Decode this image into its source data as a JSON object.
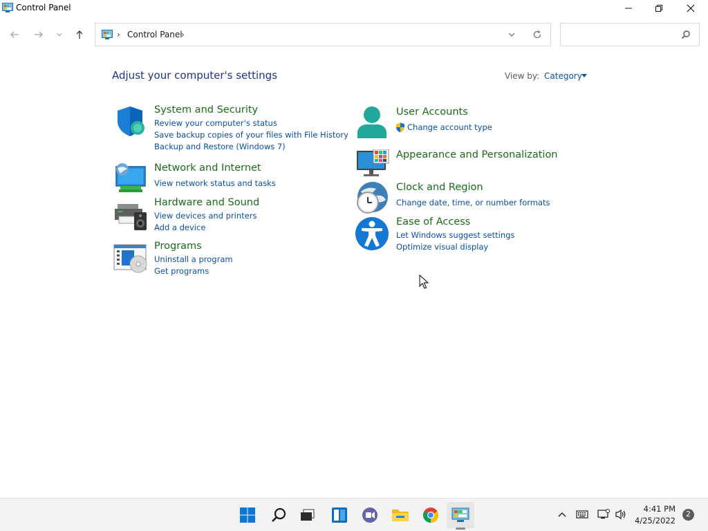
{
  "window": {
    "title": "Control Panel"
  },
  "address_bar": {
    "breadcrumbs": [
      "Control Panel"
    ],
    "search_placeholder": ""
  },
  "header": {
    "heading": "Adjust your computer's settings",
    "view_by_label": "View by:",
    "view_by_value": "Category"
  },
  "categories": [
    {
      "title": "System and Security",
      "icon": "shield-icon",
      "links": [
        "Review your computer's status",
        "Save backup copies of your files with File History",
        "Backup and Restore (Windows 7)"
      ]
    },
    {
      "title": "Network and Internet",
      "icon": "network-globe-icon",
      "links": [
        "View network status and tasks"
      ]
    },
    {
      "title": "Hardware and Sound",
      "icon": "printer-speaker-icon",
      "links": [
        "View devices and printers",
        "Add a device"
      ]
    },
    {
      "title": "Programs",
      "icon": "programs-disc-icon",
      "links": [
        "Uninstall a program",
        "Get programs"
      ]
    },
    {
      "title": "User Accounts",
      "icon": "user-icon",
      "links": [
        "Change account type"
      ]
    },
    {
      "title": "Appearance and Personalization",
      "icon": "monitor-palette-icon",
      "links": []
    },
    {
      "title": "Clock and Region",
      "icon": "clock-globe-icon",
      "links": [
        "Change date, time, or number formats"
      ]
    },
    {
      "title": "Ease of Access",
      "icon": "accessibility-icon",
      "links": [
        "Let Windows suggest settings",
        "Optimize visual display"
      ]
    }
  ],
  "taskbar": {
    "apps": [
      "start-icon",
      "search-icon",
      "task-view-icon",
      "widgets-icon",
      "chat-icon",
      "file-explorer-icon",
      "chrome-icon",
      "control-panel-icon"
    ],
    "tray_icons": [
      "chevron-up-icon",
      "keyboard-icon",
      "network-icon",
      "volume-icon"
    ],
    "time": "4:41 PM",
    "date": "4/25/2022",
    "notification_count": "2"
  },
  "colors": {
    "category_title": "#1b6a1b",
    "link": "#0a4fa8",
    "heading": "#1e3287",
    "taskbar_bg": "#f3f3f3"
  }
}
